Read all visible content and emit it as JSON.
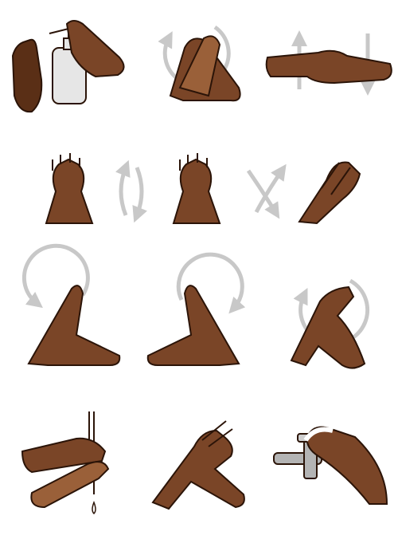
{
  "palette": {
    "skin_dark": "#5a2f16",
    "skin_mid": "#7a4527",
    "skin_light": "#9a6039",
    "outline": "#2b1408",
    "arrow": "#c8c8c8",
    "bottle": "#e6e6e6",
    "faucet": "#b4b4b4"
  },
  "steps": [
    {
      "id": "step-1-apply-soap",
      "icon": "soap-dispenser-icon",
      "arrow": "none"
    },
    {
      "id": "step-2-palm-to-palm",
      "icon": "palm-rub-icon",
      "arrow": "circular"
    },
    {
      "id": "step-3-rub-back-of-hands",
      "icon": "back-rub-icon",
      "arrow": "up-down"
    },
    {
      "id": "step-4-interlaced-fingers",
      "icon": "interlace-icon",
      "arrow": "none"
    },
    {
      "id": "step-5-fingers-rotate",
      "icon": "interlace-icon",
      "arrow": "rotate-pair"
    },
    {
      "id": "step-6-interlace-cross",
      "icon": "interlace-cross-icon",
      "arrow": "cross"
    },
    {
      "id": "step-7-rotational-rub-left",
      "icon": "rotational-rub-icon",
      "arrow": "circular"
    },
    {
      "id": "step-8-rotational-rub-right",
      "icon": "rotational-rub-icon",
      "arrow": "circular"
    },
    {
      "id": "step-9-fingertips-palm",
      "icon": "fingertip-rub-icon",
      "arrow": "circular"
    },
    {
      "id": "step-10-rinse",
      "icon": "rinse-water-icon",
      "arrow": "none"
    },
    {
      "id": "step-11-rub-dry",
      "icon": "rub-hands-icon",
      "arrow": "none"
    },
    {
      "id": "step-12-close-tap",
      "icon": "faucet-icon",
      "arrow": "none"
    }
  ]
}
